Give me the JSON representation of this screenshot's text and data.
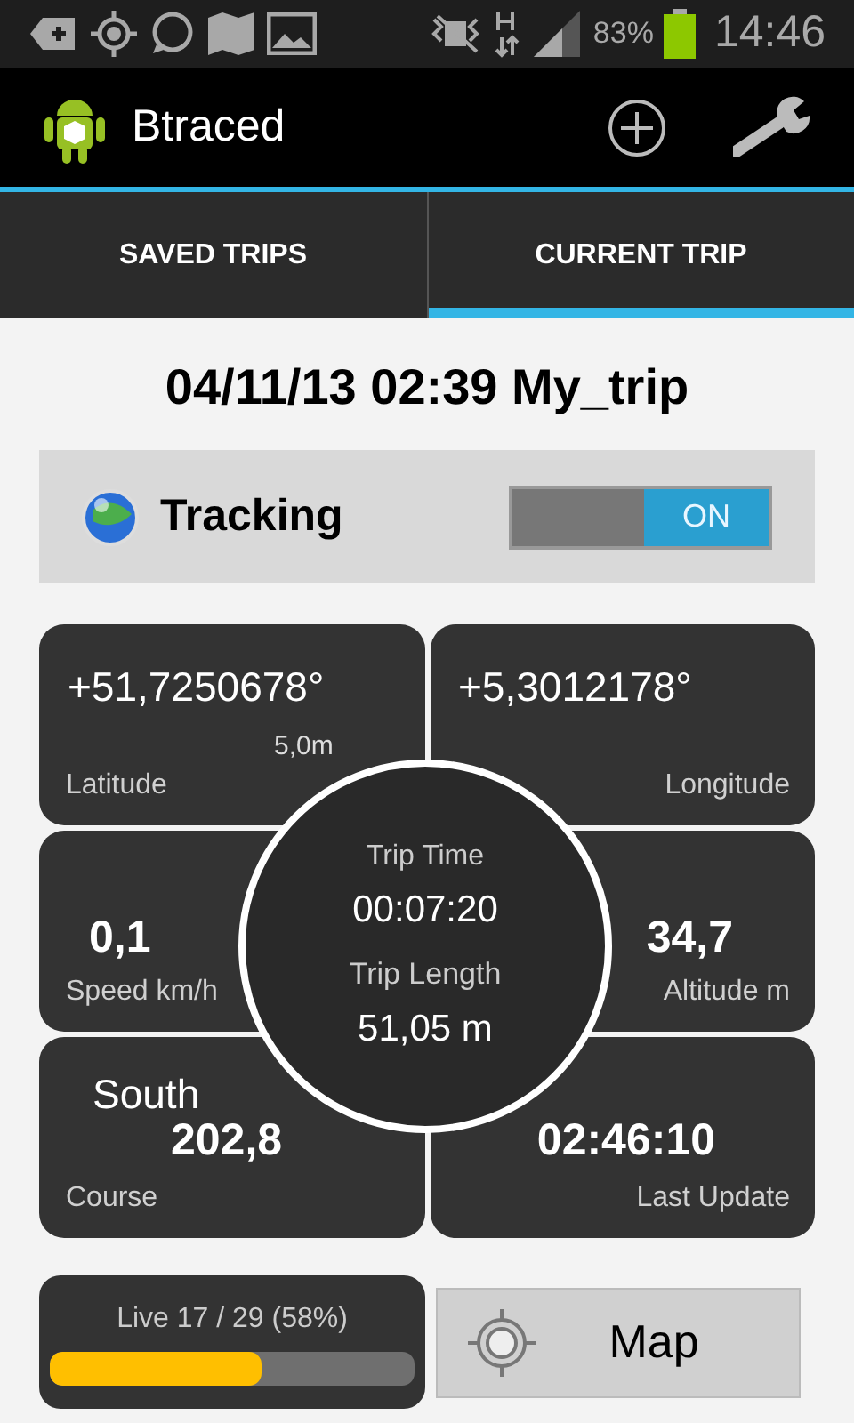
{
  "status_bar": {
    "battery": "83%",
    "time": "14:46"
  },
  "app_bar": {
    "title": "Btraced"
  },
  "tabs": [
    {
      "label": "SAVED TRIPS",
      "selected": false
    },
    {
      "label": "CURRENT TRIP",
      "selected": true
    }
  ],
  "trip_title": "04/11/13 02:39 My_trip",
  "tracking": {
    "label": "Tracking",
    "on": true,
    "on_label": "ON"
  },
  "tiles": [
    {
      "value": "+51,7250678°",
      "sub": "5,0m",
      "label": "Latitude"
    },
    {
      "value": "+5,3012178°",
      "label": "Longitude"
    },
    {
      "value": "0,1",
      "label": "Speed km/h"
    },
    {
      "value": "34,7",
      "label": "Altitude m"
    },
    {
      "value": "202,8",
      "sub": "South",
      "label": "Course"
    },
    {
      "value": "02:46:10",
      "label": "Last Update"
    }
  ],
  "center": {
    "time_label": "Trip Time",
    "time": "00:07:20",
    "length_label": "Trip Length",
    "length": "51,05 m"
  },
  "live": {
    "text": "Live 17 / 29 (58%)",
    "level": 0.58
  },
  "map_button": {
    "label": "Map"
  }
}
